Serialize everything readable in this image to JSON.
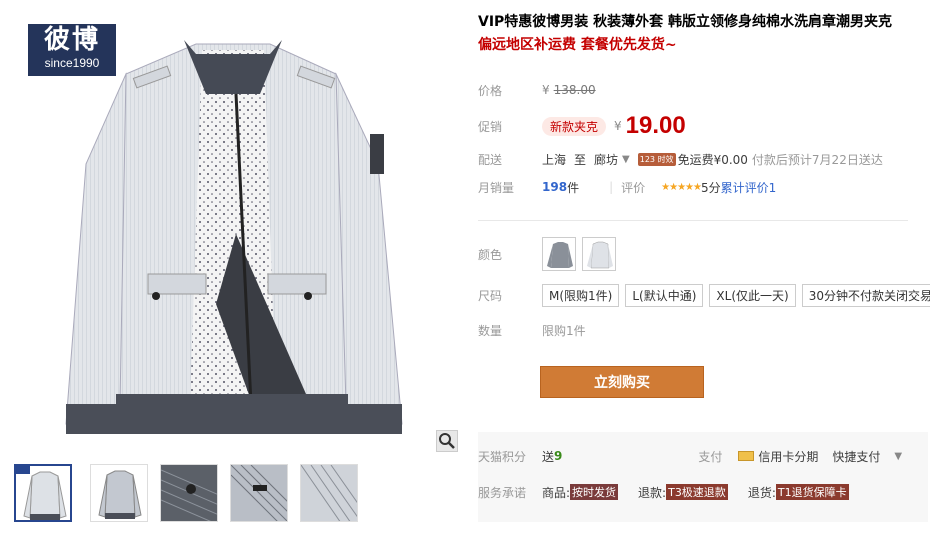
{
  "brand": {
    "name_cn": "彼博",
    "tagline": "since1990"
  },
  "product": {
    "title": "VIP特惠彼博男装 秋装薄外套 韩版立领修身纯棉水洗肩章潮男夹克",
    "subtitle": "偏远地区补运费 套餐优先发货~"
  },
  "price": {
    "label": "价格",
    "currency": "¥",
    "original": "138.00"
  },
  "promo": {
    "label": "促销",
    "tag": "新款夹克",
    "currency": "¥",
    "value": "19.00"
  },
  "delivery": {
    "label": "配送",
    "from": "上海",
    "to_word": "至",
    "to": "廊坊",
    "badge": "123 时效",
    "fee_text": "免运费¥0.00",
    "eta": "付款后预计7月22日送达"
  },
  "sales": {
    "label": "月销量",
    "count": "198",
    "unit": "件",
    "rating_label": "评价",
    "stars": "★★★★★",
    "score": "5分",
    "review_link": "累计评价1"
  },
  "color": {
    "label": "颜色"
  },
  "size": {
    "label": "尺码",
    "options": [
      "M(限购1件)",
      "L(默认中通)",
      "XL(仅此一天)",
      "30分钟不付款关闭交易"
    ]
  },
  "quantity": {
    "label": "数量",
    "limit": "限购1件"
  },
  "buy_button": "立刻购买",
  "points": {
    "label": "天猫积分",
    "send_word": "送",
    "value": "9",
    "pay_label": "支付",
    "card_label": "信用卡分期",
    "quick_label": "快捷支付"
  },
  "service": {
    "label": "服务承诺",
    "goods_label": "商品:",
    "goods_tag": "按时发货",
    "refund_label": "退款:",
    "refund_tag": "T3极速退款",
    "return_label": "退货:",
    "return_tag": "T1退货保障卡"
  },
  "colors": {
    "accent": "#c40000",
    "brand_blue": "#24345a",
    "buy_orange": "#d07b35"
  }
}
